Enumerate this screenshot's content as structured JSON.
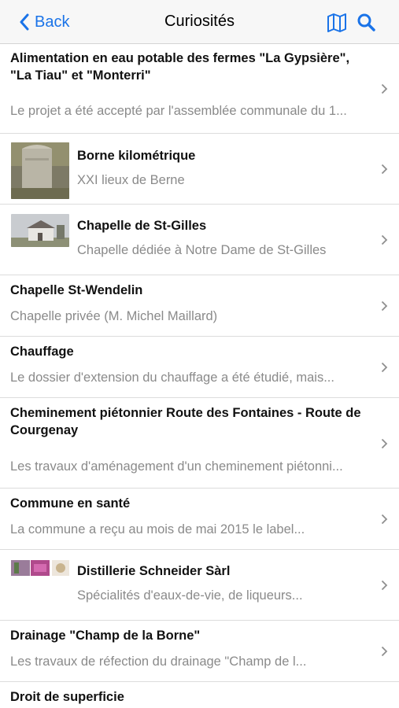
{
  "nav": {
    "back_label": "Back",
    "title": "Curiosités",
    "map_icon": "map-icon",
    "search_icon": "search-icon",
    "accent": "#1a73e8"
  },
  "items": [
    {
      "title": "Alimentation en eau potable des fermes \"La Gypsière\", \"La Tiau\" et \"Monterri\"",
      "subtitle": "Le projet a été accepté par l'assemblée communale du 1..."
    },
    {
      "title": "Borne kilométrique",
      "subtitle": "XXI lieux de Berne",
      "thumbnail": "milestone-photo"
    },
    {
      "title": "Chapelle de St-Gilles",
      "subtitle": "Chapelle dédiée à Notre Dame de St-Gilles",
      "thumbnail": "chapel-photo"
    },
    {
      "title": "Chapelle St-Wendelin",
      "subtitle": "Chapelle privée (M. Michel Maillard)"
    },
    {
      "title": "Chauffage",
      "subtitle": "Le dossier d'extension du chauffage a été étudié, mais..."
    },
    {
      "title": "Cheminement piétonnier Route des Fontaines - Route de Courgenay",
      "subtitle": "Les travaux d'aménagement d'un cheminement piétonni..."
    },
    {
      "title": "Commune en santé",
      "subtitle": "La commune a reçu au mois de mai 2015 le label..."
    },
    {
      "title": "Distillerie Schneider Sàrl",
      "subtitle": "Spécialités d'eaux-de-vie, de liqueurs...",
      "thumbnail": "distillery-photo"
    },
    {
      "title": "Drainage \"Champ de la Borne\"",
      "subtitle": "Les travaux de réfection du drainage \"Champ de l..."
    },
    {
      "title": "Droit de superficie",
      "subtitle": ""
    }
  ]
}
